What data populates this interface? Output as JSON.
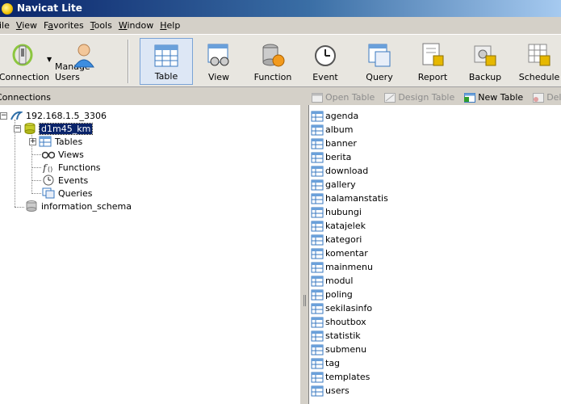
{
  "app": {
    "title": "Navicat Lite"
  },
  "menu": [
    {
      "label": "File",
      "accel": "F",
      "rest": "ile"
    },
    {
      "label": "View",
      "accel": "V",
      "rest": "iew"
    },
    {
      "label": "Favorites",
      "accel": "a",
      "pre": "F",
      "rest": "vorites"
    },
    {
      "label": "Tools",
      "accel": "T",
      "rest": "ools"
    },
    {
      "label": "Window",
      "accel": "W",
      "rest": "indow"
    },
    {
      "label": "Help",
      "accel": "H",
      "rest": "elp"
    }
  ],
  "toolbar": {
    "connection": "Connection",
    "manage_users": "Manage Users",
    "table": "Table",
    "view": "View",
    "function": "Function",
    "event": "Event",
    "query": "Query",
    "report": "Report",
    "backup": "Backup",
    "schedule": "Schedule"
  },
  "connections_header": "Connections",
  "object_toolbar": {
    "open_table": "Open Table",
    "design_table": "Design Table",
    "new_table": "New Table",
    "delete": "Delete"
  },
  "tree": {
    "connection": "192.168.1.5_3306",
    "database": "d1m45_km",
    "tables": "Tables",
    "views": "Views",
    "functions": "Functions",
    "events": "Events",
    "queries": "Queries",
    "other_db": "information_schema"
  },
  "tables": [
    "agenda",
    "album",
    "banner",
    "berita",
    "download",
    "gallery",
    "halamanstatis",
    "hubungi",
    "katajelek",
    "kategori",
    "komentar",
    "mainmenu",
    "modul",
    "poling",
    "sekilasinfo",
    "shoutbox",
    "statistik",
    "submenu",
    "tag",
    "templates",
    "users"
  ],
  "colors": {
    "title_start": "#0a246a",
    "selection": "#0a246a",
    "toolbar_active": "#dde7f5"
  }
}
